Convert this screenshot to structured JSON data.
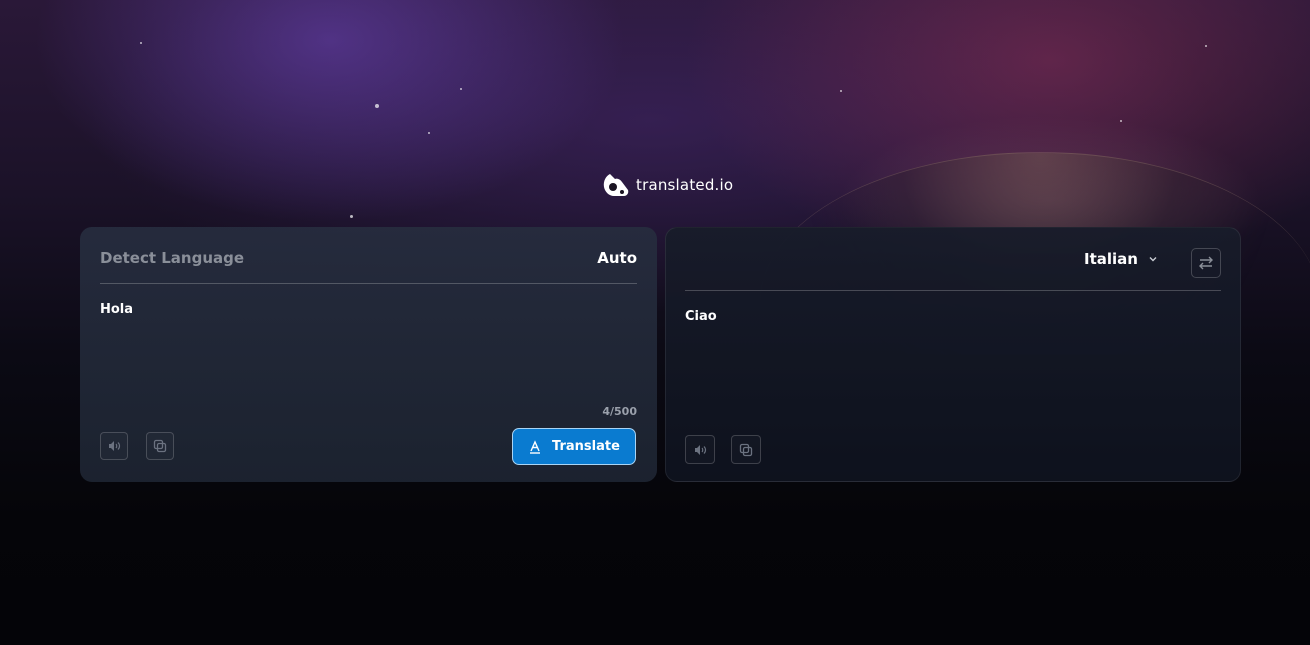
{
  "brand": {
    "name": "translated.io",
    "logo_icon": "translate-logo-icon"
  },
  "source": {
    "language_label": "Detect Language",
    "detected": "Auto",
    "text": "Hola",
    "char_count": "4/500",
    "speak_icon": "speaker-icon",
    "copy_icon": "copy-icon",
    "translate_label": "Translate",
    "translate_icon": "translate-icon"
  },
  "target": {
    "language": "Italian",
    "dropdown_icon": "chevron-down-icon",
    "swap_icon": "swap-icon",
    "text": "Ciao",
    "speak_icon": "speaker-icon",
    "copy_icon": "copy-icon"
  },
  "colors": {
    "accent": "#0a7bd0",
    "panel_left": "#262c3e",
    "panel_right": "#181c2a"
  }
}
